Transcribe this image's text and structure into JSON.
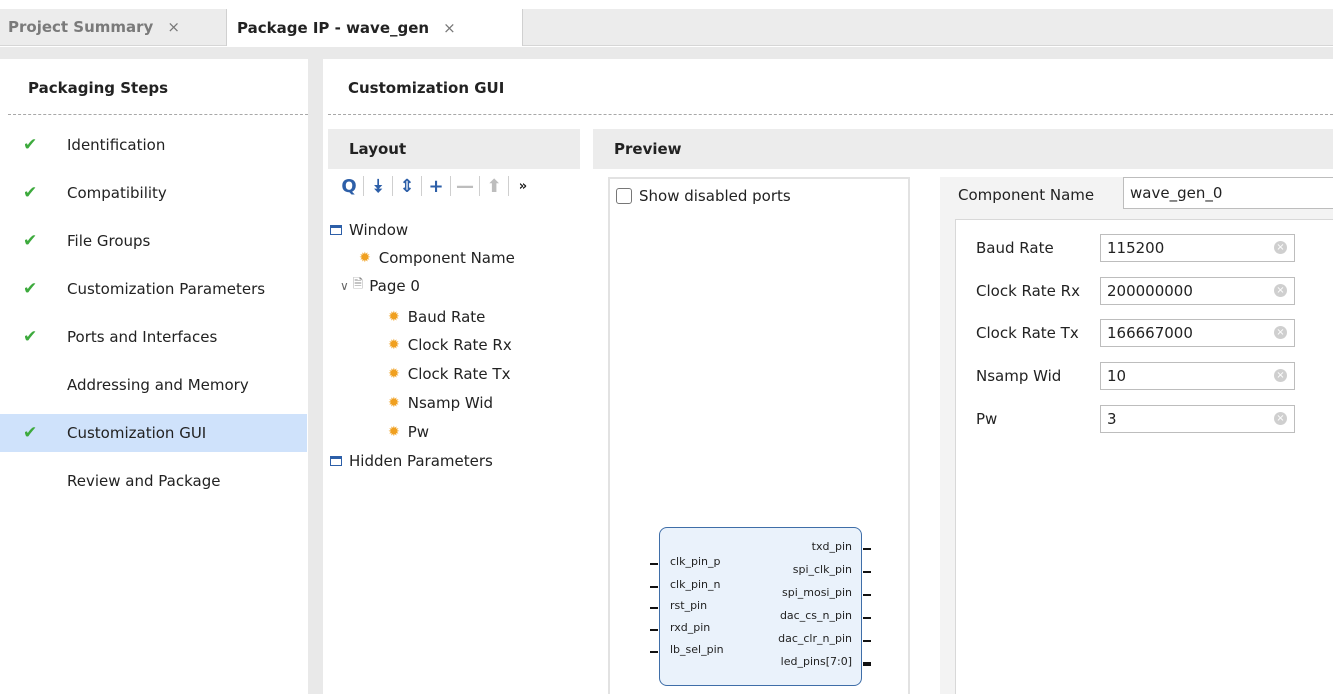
{
  "tabs": [
    {
      "label": "Project Summary",
      "close": "×"
    },
    {
      "label": "Package IP - wave_gen",
      "close": "×"
    }
  ],
  "steps_panel": {
    "title": "Packaging Steps",
    "items": [
      {
        "label": "Identification",
        "check": "✔"
      },
      {
        "label": "Compatibility",
        "check": "✔"
      },
      {
        "label": "File Groups",
        "check": "✔"
      },
      {
        "label": "Customization Parameters",
        "check": "✔"
      },
      {
        "label": "Ports and Interfaces",
        "check": "✔"
      },
      {
        "label": "Addressing and Memory",
        "check": ""
      },
      {
        "label": "Customization GUI",
        "check": "✔"
      },
      {
        "label": "Review and Package",
        "check": ""
      }
    ]
  },
  "main": {
    "title": "Customization GUI",
    "layout": {
      "title": "Layout",
      "toolbar": {
        "search": "Q",
        "collapse": "⯯",
        "expand": "⇕",
        "add": "+",
        "remove": "—",
        "up": "⬆",
        "more": "»"
      },
      "tree": {
        "window": "Window",
        "component_name": "Component Name",
        "page": "Page 0",
        "params": [
          "Baud Rate",
          "Clock Rate Rx",
          "Clock Rate Tx",
          "Nsamp Wid",
          "Pw"
        ],
        "hidden": "Hidden Parameters"
      }
    },
    "preview": {
      "title": "Preview",
      "show_disabled_ports": "Show disabled ports",
      "block": {
        "inputs": [
          "clk_pin_p",
          "clk_pin_n",
          "rst_pin",
          "rxd_pin",
          "lb_sel_pin"
        ],
        "outputs": [
          "txd_pin",
          "spi_clk_pin",
          "spi_mosi_pin",
          "dac_cs_n_pin",
          "dac_clr_n_pin",
          "led_pins[7:0]"
        ]
      },
      "component_name_label": "Component Name",
      "component_name_value": "wave_gen_0",
      "parameters": [
        {
          "label": "Baud Rate",
          "value": "115200"
        },
        {
          "label": "Clock Rate Rx",
          "value": "200000000"
        },
        {
          "label": "Clock Rate Tx",
          "value": "166667000"
        },
        {
          "label": "Nsamp Wid",
          "value": "10"
        },
        {
          "label": "Pw",
          "value": "3"
        }
      ]
    }
  }
}
